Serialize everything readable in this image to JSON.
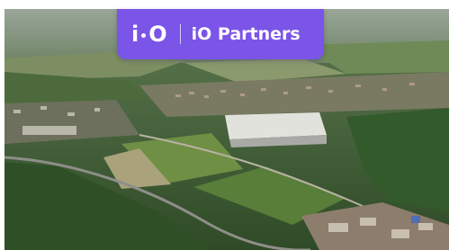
{
  "banner": {
    "logo_letter_left": "i",
    "logo_letter_right": "O",
    "brand_name": "iO Partners",
    "background_color": "#7b54e8"
  },
  "photo": {
    "subject": "aerial-view"
  }
}
